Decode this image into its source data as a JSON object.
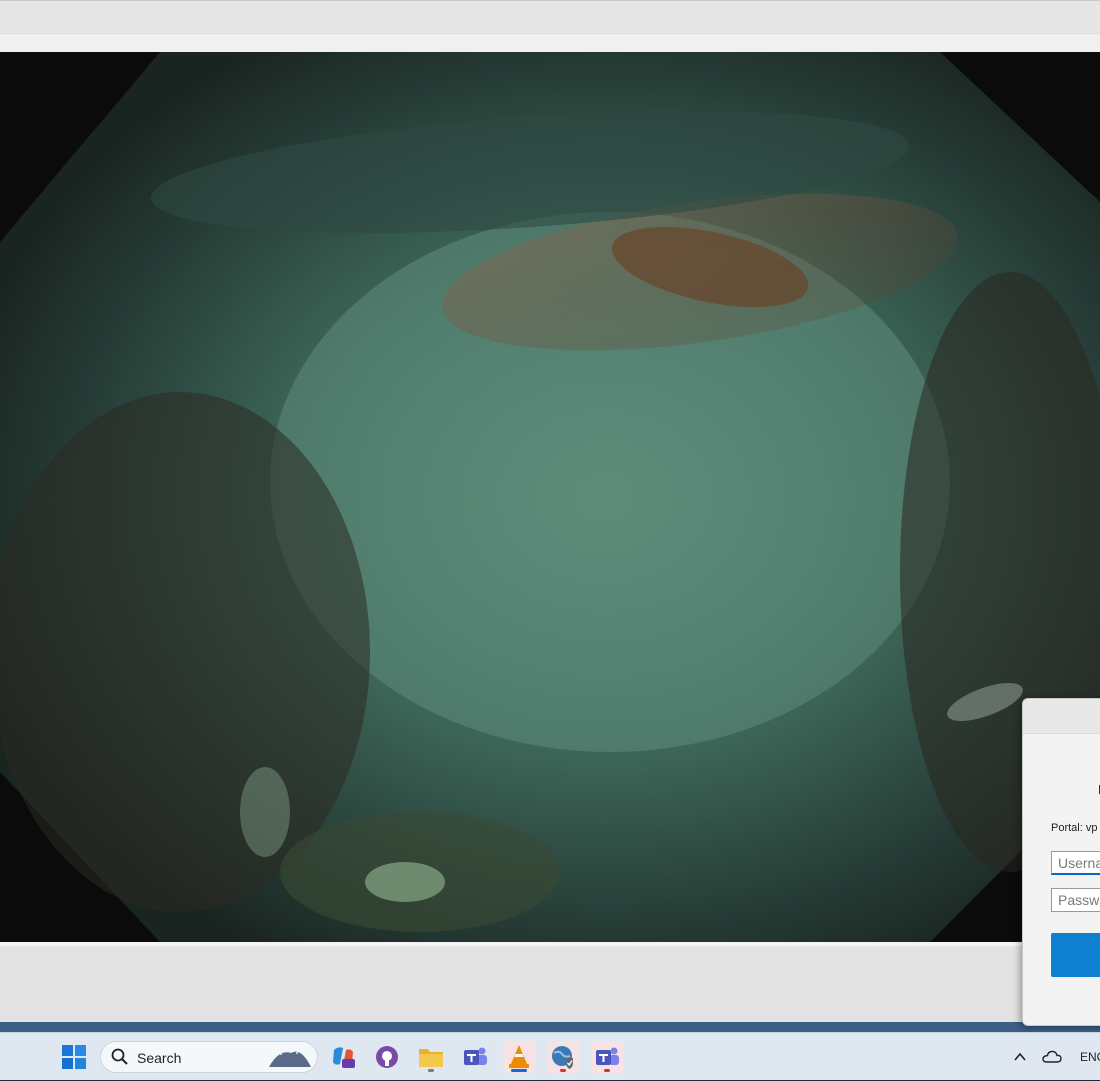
{
  "taskbar": {
    "search_label": "Search",
    "apps": [
      {
        "name": "Copilot",
        "icon": "copilot-icon"
      },
      {
        "name": "GitHub",
        "icon": "github-icon"
      },
      {
        "name": "File Explorer",
        "icon": "folder-icon"
      },
      {
        "name": "Microsoft Teams",
        "icon": "teams-icon"
      },
      {
        "name": "VLC media player",
        "icon": "vlc-icon"
      },
      {
        "name": "VPN Client",
        "icon": "globe-shield-icon"
      },
      {
        "name": "Microsoft Teams",
        "icon": "teams-icon"
      }
    ],
    "language": "ENG"
  },
  "dialog": {
    "portal_label": "Portal: vp",
    "username_placeholder": "Userna",
    "password_placeholder": "Passwo"
  },
  "colors": {
    "accent": "#0f80cf",
    "taskbar_bg": "#dfe8f1",
    "running_indicator": "#d13438"
  }
}
